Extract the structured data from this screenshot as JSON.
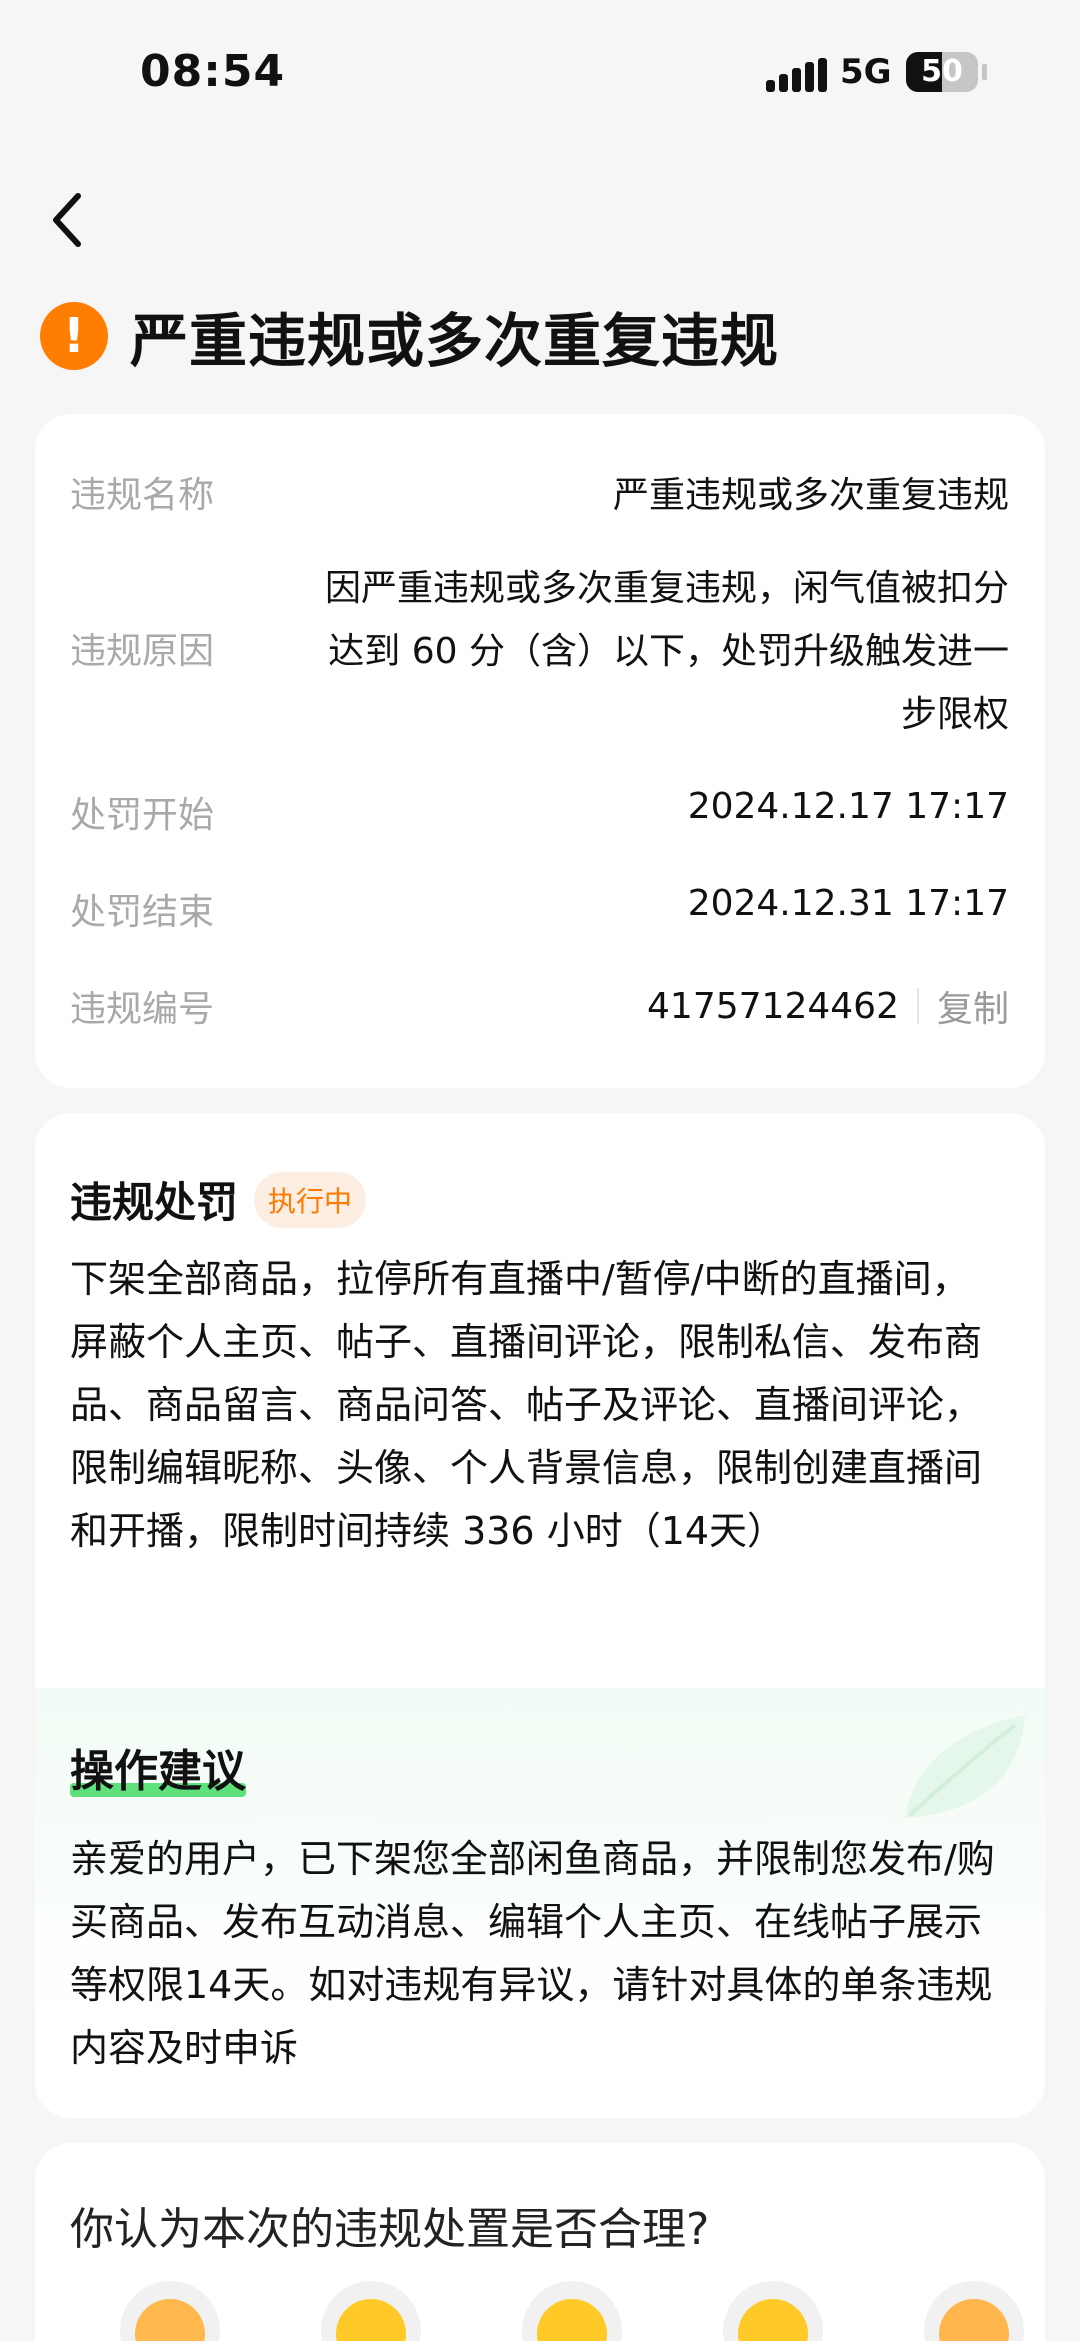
{
  "status_bar": {
    "time": "08:54",
    "network": "5G",
    "battery": "50"
  },
  "header": {
    "title": "严重违规或多次重复违规"
  },
  "details": {
    "rows": [
      {
        "label": "违规名称",
        "value": "严重违规或多次重复违规"
      },
      {
        "label": "违规原因",
        "value": "因严重违规或多次重复违规，闲气值被扣分达到 60 分（含）以下，处罚升级触发进一步限权"
      },
      {
        "label": "处罚开始",
        "value": "2024.12.17 17:17"
      },
      {
        "label": "处罚结束",
        "value": "2024.12.31 17:17"
      },
      {
        "label": "违规编号",
        "value": "41757124462"
      }
    ],
    "copy_label": "复制"
  },
  "penalty": {
    "title": "违规处罚",
    "status_badge": "执行中",
    "description": "下架全部商品，拉停所有直播中/暂停/中断的直播间，屏蔽个人主页、帖子、直播间评论，限制私信、发布商品、商品留言、商品问答、帖子及评论、直播间评论，限制编辑昵称、头像、个人背景信息，限制创建直播间和开播，限制时间持续 336 小时（14天）"
  },
  "advice": {
    "title": "操作建议",
    "text": "亲爱的用户，已下架您全部闲鱼商品，并限制您发布/购买商品、发布互动消息、编辑个人主页、在线帖子展示等权限14天。如对违规有异议，请针对具体的单条违规内容及时申诉"
  },
  "feedback": {
    "question": "你认为本次的违规处置是否合理?",
    "options": [
      "angry-face-icon",
      "unamused-face-icon",
      "flushed-face-icon",
      "thinking-face-icon",
      "blushing-face-icon"
    ]
  },
  "colors": {
    "warning": "#ff7d00",
    "badge_text": "#ff7a00",
    "highlight": "#5ee07a"
  }
}
